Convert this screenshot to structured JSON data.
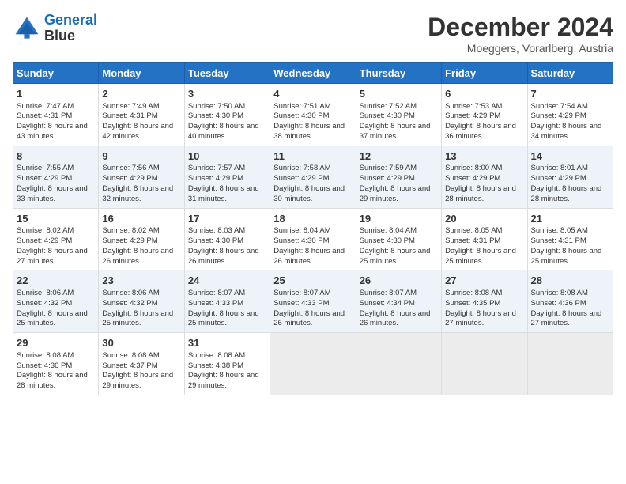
{
  "header": {
    "logo_line1": "General",
    "logo_line2": "Blue",
    "title": "December 2024",
    "subtitle": "Moeggers, Vorarlberg, Austria"
  },
  "columns": [
    "Sunday",
    "Monday",
    "Tuesday",
    "Wednesday",
    "Thursday",
    "Friday",
    "Saturday"
  ],
  "weeks": [
    {
      "row_class": "week-row-1",
      "days": [
        {
          "num": "1",
          "rise": "Sunrise: 7:47 AM",
          "set": "Sunset: 4:31 PM",
          "day": "Daylight: 8 hours and 43 minutes."
        },
        {
          "num": "2",
          "rise": "Sunrise: 7:49 AM",
          "set": "Sunset: 4:31 PM",
          "day": "Daylight: 8 hours and 42 minutes."
        },
        {
          "num": "3",
          "rise": "Sunrise: 7:50 AM",
          "set": "Sunset: 4:30 PM",
          "day": "Daylight: 8 hours and 40 minutes."
        },
        {
          "num": "4",
          "rise": "Sunrise: 7:51 AM",
          "set": "Sunset: 4:30 PM",
          "day": "Daylight: 8 hours and 38 minutes."
        },
        {
          "num": "5",
          "rise": "Sunrise: 7:52 AM",
          "set": "Sunset: 4:30 PM",
          "day": "Daylight: 8 hours and 37 minutes."
        },
        {
          "num": "6",
          "rise": "Sunrise: 7:53 AM",
          "set": "Sunset: 4:29 PM",
          "day": "Daylight: 8 hours and 36 minutes."
        },
        {
          "num": "7",
          "rise": "Sunrise: 7:54 AM",
          "set": "Sunset: 4:29 PM",
          "day": "Daylight: 8 hours and 34 minutes."
        }
      ]
    },
    {
      "row_class": "week-row-2",
      "days": [
        {
          "num": "8",
          "rise": "Sunrise: 7:55 AM",
          "set": "Sunset: 4:29 PM",
          "day": "Daylight: 8 hours and 33 minutes."
        },
        {
          "num": "9",
          "rise": "Sunrise: 7:56 AM",
          "set": "Sunset: 4:29 PM",
          "day": "Daylight: 8 hours and 32 minutes."
        },
        {
          "num": "10",
          "rise": "Sunrise: 7:57 AM",
          "set": "Sunset: 4:29 PM",
          "day": "Daylight: 8 hours and 31 minutes."
        },
        {
          "num": "11",
          "rise": "Sunrise: 7:58 AM",
          "set": "Sunset: 4:29 PM",
          "day": "Daylight: 8 hours and 30 minutes."
        },
        {
          "num": "12",
          "rise": "Sunrise: 7:59 AM",
          "set": "Sunset: 4:29 PM",
          "day": "Daylight: 8 hours and 29 minutes."
        },
        {
          "num": "13",
          "rise": "Sunrise: 8:00 AM",
          "set": "Sunset: 4:29 PM",
          "day": "Daylight: 8 hours and 28 minutes."
        },
        {
          "num": "14",
          "rise": "Sunrise: 8:01 AM",
          "set": "Sunset: 4:29 PM",
          "day": "Daylight: 8 hours and 28 minutes."
        }
      ]
    },
    {
      "row_class": "week-row-3",
      "days": [
        {
          "num": "15",
          "rise": "Sunrise: 8:02 AM",
          "set": "Sunset: 4:29 PM",
          "day": "Daylight: 8 hours and 27 minutes."
        },
        {
          "num": "16",
          "rise": "Sunrise: 8:02 AM",
          "set": "Sunset: 4:29 PM",
          "day": "Daylight: 8 hours and 26 minutes."
        },
        {
          "num": "17",
          "rise": "Sunrise: 8:03 AM",
          "set": "Sunset: 4:30 PM",
          "day": "Daylight: 8 hours and 26 minutes."
        },
        {
          "num": "18",
          "rise": "Sunrise: 8:04 AM",
          "set": "Sunset: 4:30 PM",
          "day": "Daylight: 8 hours and 26 minutes."
        },
        {
          "num": "19",
          "rise": "Sunrise: 8:04 AM",
          "set": "Sunset: 4:30 PM",
          "day": "Daylight: 8 hours and 25 minutes."
        },
        {
          "num": "20",
          "rise": "Sunrise: 8:05 AM",
          "set": "Sunset: 4:31 PM",
          "day": "Daylight: 8 hours and 25 minutes."
        },
        {
          "num": "21",
          "rise": "Sunrise: 8:05 AM",
          "set": "Sunset: 4:31 PM",
          "day": "Daylight: 8 hours and 25 minutes."
        }
      ]
    },
    {
      "row_class": "week-row-4",
      "days": [
        {
          "num": "22",
          "rise": "Sunrise: 8:06 AM",
          "set": "Sunset: 4:32 PM",
          "day": "Daylight: 8 hours and 25 minutes."
        },
        {
          "num": "23",
          "rise": "Sunrise: 8:06 AM",
          "set": "Sunset: 4:32 PM",
          "day": "Daylight: 8 hours and 25 minutes."
        },
        {
          "num": "24",
          "rise": "Sunrise: 8:07 AM",
          "set": "Sunset: 4:33 PM",
          "day": "Daylight: 8 hours and 25 minutes."
        },
        {
          "num": "25",
          "rise": "Sunrise: 8:07 AM",
          "set": "Sunset: 4:33 PM",
          "day": "Daylight: 8 hours and 26 minutes."
        },
        {
          "num": "26",
          "rise": "Sunrise: 8:07 AM",
          "set": "Sunset: 4:34 PM",
          "day": "Daylight: 8 hours and 26 minutes."
        },
        {
          "num": "27",
          "rise": "Sunrise: 8:08 AM",
          "set": "Sunset: 4:35 PM",
          "day": "Daylight: 8 hours and 27 minutes."
        },
        {
          "num": "28",
          "rise": "Sunrise: 8:08 AM",
          "set": "Sunset: 4:36 PM",
          "day": "Daylight: 8 hours and 27 minutes."
        }
      ]
    },
    {
      "row_class": "week-row-5",
      "days": [
        {
          "num": "29",
          "rise": "Sunrise: 8:08 AM",
          "set": "Sunset: 4:36 PM",
          "day": "Daylight: 8 hours and 28 minutes."
        },
        {
          "num": "30",
          "rise": "Sunrise: 8:08 AM",
          "set": "Sunset: 4:37 PM",
          "day": "Daylight: 8 hours and 29 minutes."
        },
        {
          "num": "31",
          "rise": "Sunrise: 8:08 AM",
          "set": "Sunset: 4:38 PM",
          "day": "Daylight: 8 hours and 29 minutes."
        },
        null,
        null,
        null,
        null
      ]
    }
  ]
}
